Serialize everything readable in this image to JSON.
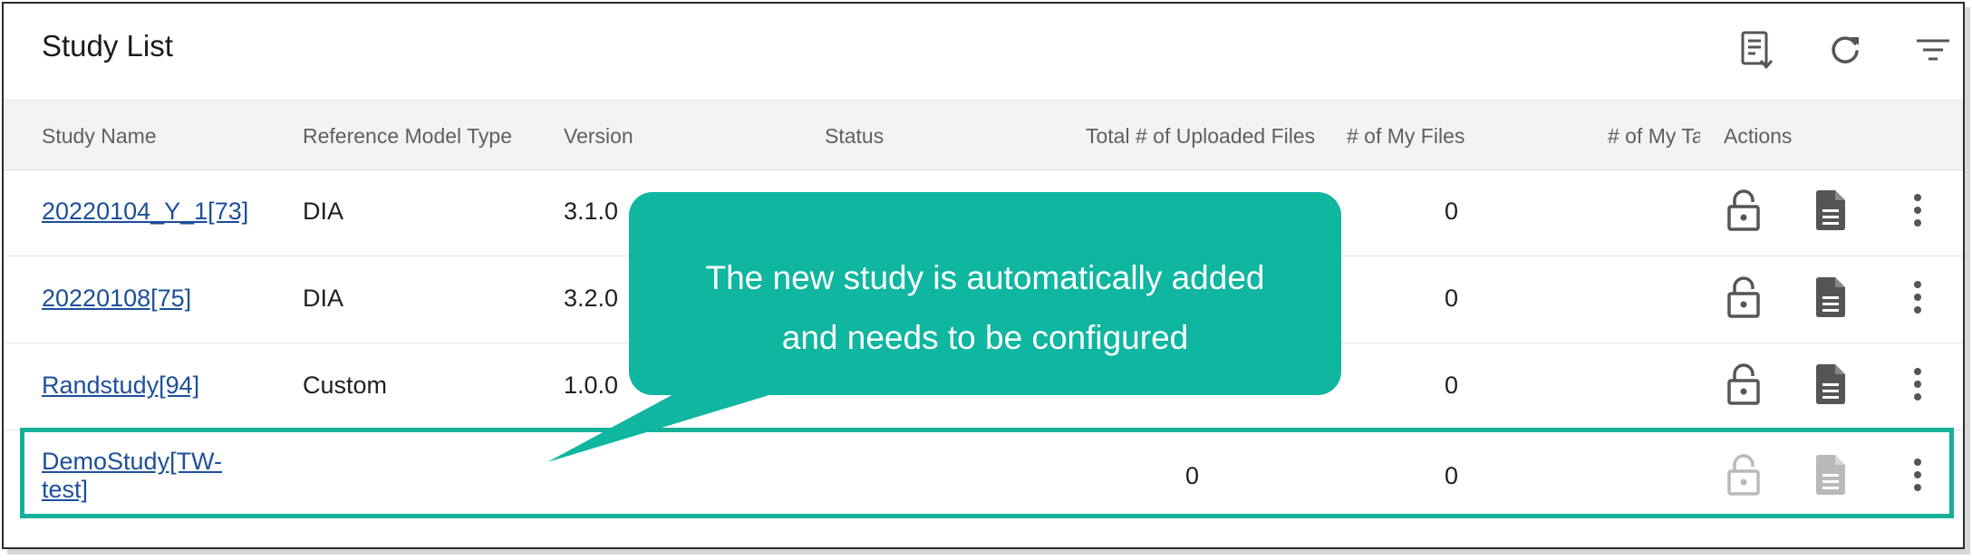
{
  "page": {
    "title": "Study List"
  },
  "toolbar": {
    "export_icon": "export-list-icon",
    "refresh_icon": "refresh-icon",
    "filter_icon": "filter-icon"
  },
  "table": {
    "headers": [
      "Study Name",
      "Reference Model Type",
      "Version",
      "Status",
      "Total # of Uploaded Files",
      "# of My Files",
      "# of My Ta",
      "Actions"
    ],
    "rows": [
      {
        "name": "20220104_Y_1[73]",
        "model": "DIA",
        "version": "3.1.0",
        "total": "",
        "my_files": "0"
      },
      {
        "name": "20220108[75]",
        "model": "DIA",
        "version": "3.2.0",
        "total": "",
        "my_files": "0"
      },
      {
        "name": "Randstudy[94]",
        "model": "Custom",
        "version": "1.0.0",
        "total": "",
        "my_files": "0"
      },
      {
        "name_line1": "DemoStudy[TW-",
        "name_line2": "test]",
        "model": "",
        "version": "",
        "total": "0",
        "my_files": "0"
      }
    ]
  },
  "callout": {
    "line1": "The new study is automatically added",
    "line2": "and needs to be configured"
  },
  "colors": {
    "accent": "#0fb6a0",
    "highlight_border": "#16b09a",
    "link": "#1d4f9a",
    "icon_dark": "#555555",
    "icon_disabled": "#b9b9b9"
  }
}
